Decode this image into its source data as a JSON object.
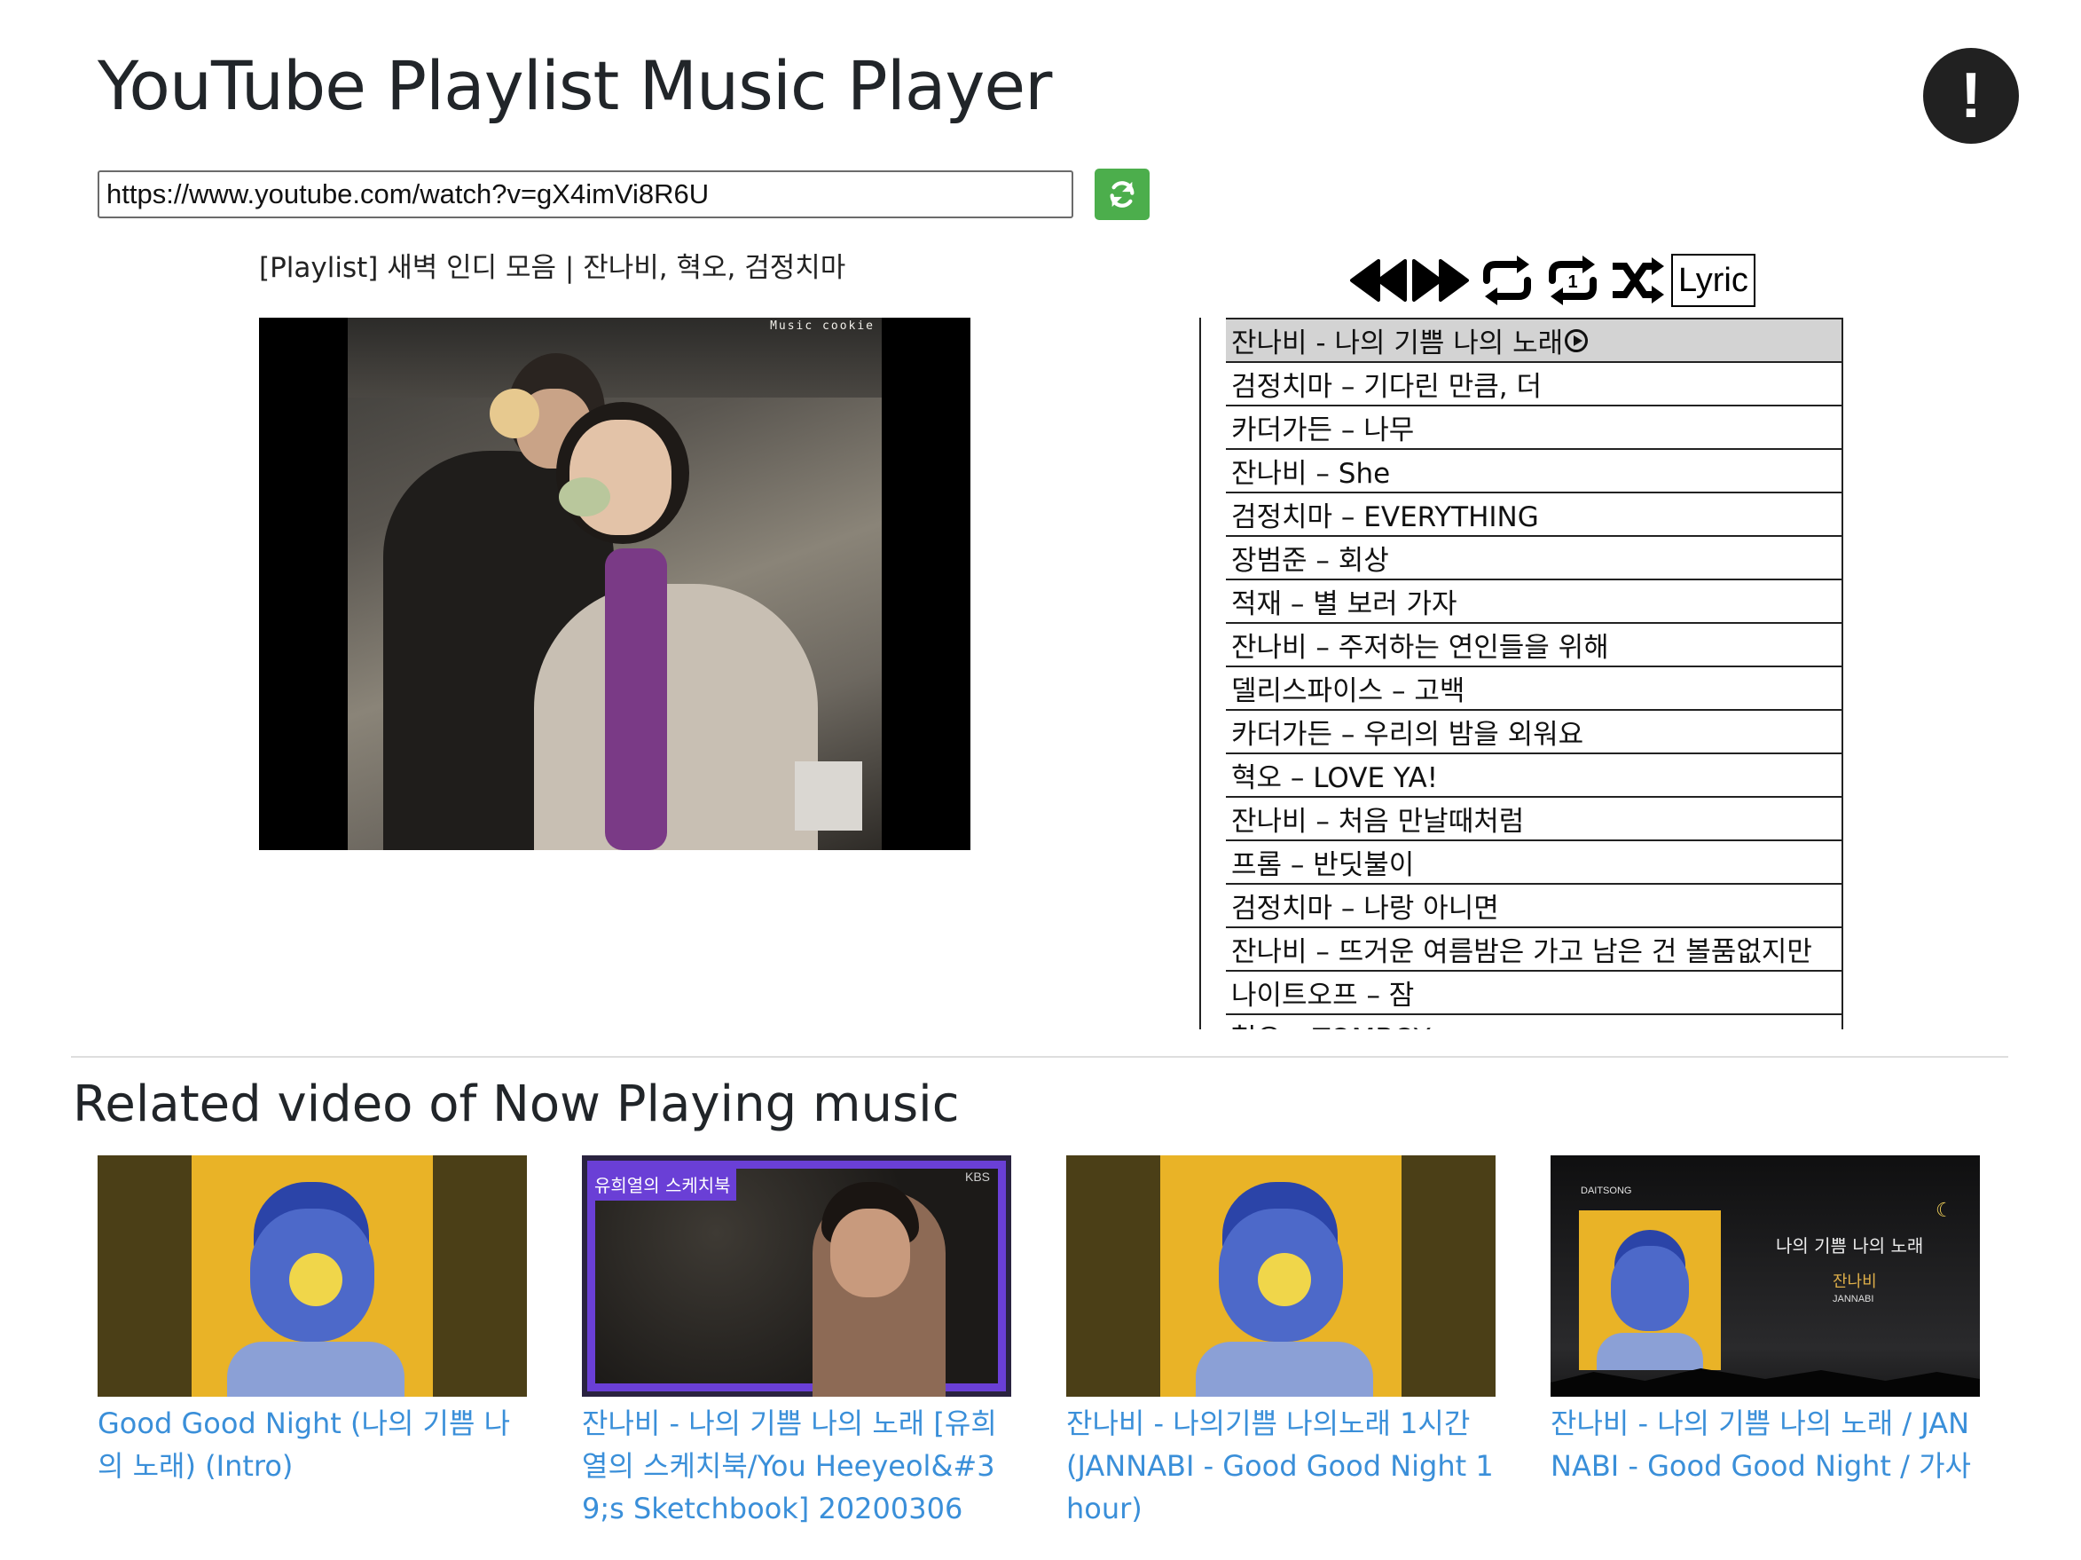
{
  "header": {
    "title": "YouTube Playlist Music Player",
    "alert_icon": "exclamation-circle-icon"
  },
  "url_bar": {
    "value": "https://www.youtube.com/watch?v=gX4imVi8R6U",
    "refresh_icon": "refresh-icon",
    "button_color": "#4cae4c"
  },
  "playlist_title": "[Playlist] 새벽 인디 모음 | 잔나비, 혁오, 검정치마",
  "player": {
    "watermark": "Music cookie"
  },
  "controls": {
    "prev_icon": "backward-icon",
    "next_icon": "forward-icon",
    "repeat_icon": "repeat-icon",
    "repeat_one_icon": "repeat-one-icon",
    "shuffle_icon": "shuffle-icon",
    "lyric_label": "Lyric"
  },
  "playlist": {
    "items": [
      "잔나비 - 나의 기쁨 나의 노래",
      "검정치마 – 기다린 만큼, 더",
      "카더가든 – 나무",
      "잔나비 – She",
      "검정치마 – EVERYTHING",
      "장범준 – 회상",
      "적재 – 별 보러 가자",
      "잔나비 – 주저하는 연인들을 위해",
      "델리스파이스 – 고백",
      "카더가든 – 우리의 밤을 외워요",
      "혁오 – LOVE YA!",
      "잔나비 – 처음 만날때처럼",
      "프롬 – 반딧불이",
      "검정치마 – 나랑 아니면",
      "잔나비 – 뜨거운 여름밤은 가고 남은 건 볼품없지만",
      "나이트오프 – 잠",
      "혁오 – TOMBOY"
    ],
    "active_index": 0
  },
  "related": {
    "heading": "Related video of Now Playing music",
    "videos": [
      {
        "title": "Good Good Night (나의 기쁨 나의 노래) (Intro)"
      },
      {
        "title": "잔나비 - 나의 기쁨 나의 노래 [유희열의 스케치북/You Heeyeol&#39;s Sketchbook] 20200306",
        "overlay_logo": "유희열의 스케치북",
        "channel_tag": "KBS"
      },
      {
        "title": "잔나비 - 나의기쁨 나의노래 1시간 (JANNABI - Good Good Night 1 hour)"
      },
      {
        "title": "잔나비 - 나의 기쁨 나의 노래 / JANNABI - Good Good Night / 가사",
        "overlay_title": "나의 기쁨 나의 노래",
        "overlay_artist": "잔나비",
        "overlay_artist_en": "JANNABI",
        "overlay_channel": "DAITSONG"
      }
    ]
  }
}
